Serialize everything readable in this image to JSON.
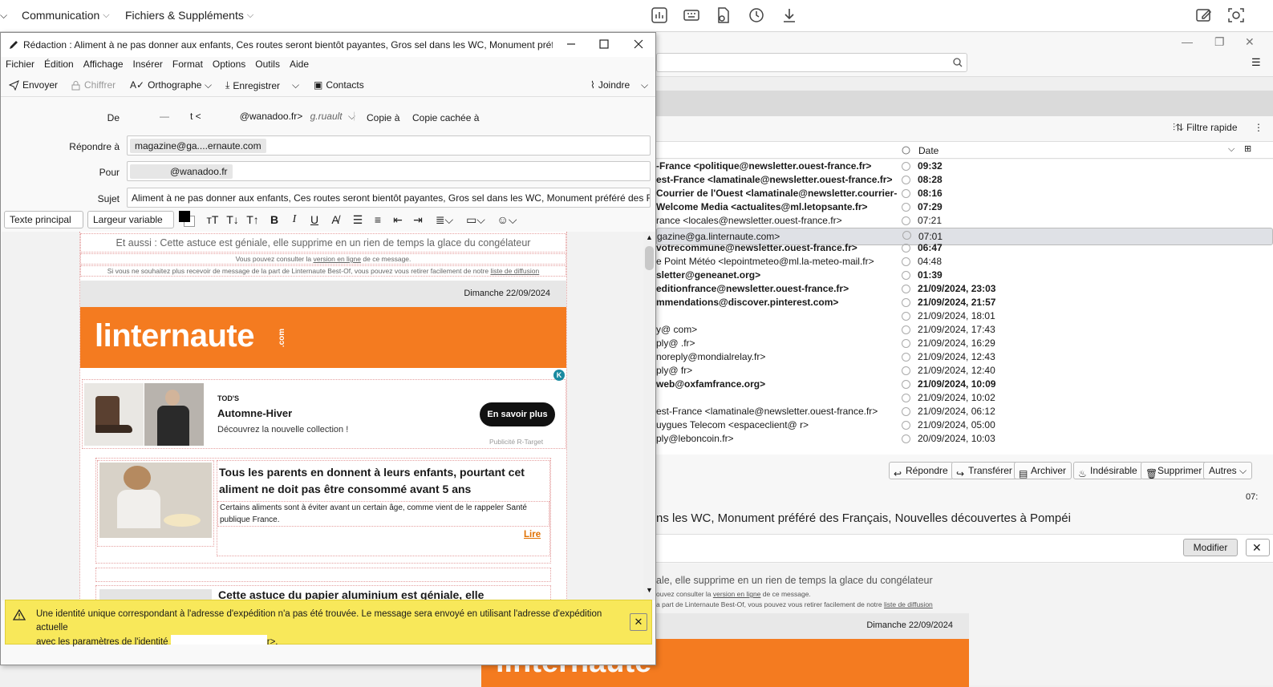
{
  "topbar": {
    "menu1": "Communication",
    "menu2": "Fichiers & Suppléments"
  },
  "compose": {
    "title": "Rédaction : Aliment à ne pas donner aux enfants, Ces routes seront bientôt payantes, Gros sel dans les WC, Monument préféré de...",
    "menu": [
      "Fichier",
      "Édition",
      "Affichage",
      "Insérer",
      "Format",
      "Options",
      "Outils",
      "Aide"
    ],
    "toolbar": {
      "send": "Envoyer",
      "encrypt": "Chiffrer",
      "spelling": "Orthographe",
      "save": "Enregistrer",
      "contacts": "Contacts",
      "attach": "Joindre"
    },
    "headers": {
      "from_label": "De",
      "from_value": "t <",
      "from_value2": "@wanadoo.fr>",
      "from_identity": "g.ruault",
      "cc": "Copie à",
      "bcc": "Copie cachée à",
      "reply_label": "Répondre à",
      "reply_value": "magazine@ga....ernaute.com",
      "to_label": "Pour",
      "to_value": "@wanadoo.fr",
      "subject_label": "Sujet",
      "subject_value": "Aliment à ne pas donner aux enfants, Ces routes seront bientôt payantes, Gros sel dans les WC, Monument préféré des Français, N"
    },
    "format": {
      "paragraph": "Texte principal",
      "font": "Largeur variable"
    },
    "newsletter": {
      "teaser": "Et aussi : Cette astuce est géniale, elle supprime en un rien de temps la glace du congélateur",
      "online_pre": "Vous pouvez consulter la ",
      "online_link": "version en ligne",
      "online_post": " de ce message.",
      "unsub_pre": "Si vous ne souhaitez plus recevoir de message de la part de Linternaute Best-Of, vous pouvez vous retirer facilement de notre ",
      "unsub_link": "liste de diffusion",
      "date": "Dimanche 22/09/2024",
      "logo": "linternaute",
      "logo_com": ".com",
      "ad_brand": "TOD'S",
      "ad_title": "Automne-Hiver",
      "ad_desc": "Découvrez la nouvelle collection !",
      "ad_cta": "En savoir plus",
      "ad_credit": "Publicité R-Target",
      "ad_badge": "K",
      "article1_title": "Tous les parents en donnent à leurs enfants, pourtant cet aliment ne doit pas être consommé avant 5 ans",
      "article1_desc": "Certains aliments sont à éviter avant un certain âge, comme vient de le rappeler Santé publique France.",
      "article1_link": "Lire",
      "article2_title": "Cette astuce du papier aluminium est géniale, elle"
    },
    "warning": {
      "line1": "Une identité unique correspondant à l'adresse d'expédition n'a pas été trouvée. Le message sera envoyé en utilisant l'adresse d'expédition actuelle",
      "line2_pre": "avec les paramètres de l'identité ",
      "line2_post": "r>."
    }
  },
  "background": {
    "filter": "Filtre rapide",
    "col_date": "Date",
    "messages": [
      {
        "from": "-France <politique@newsletter.ouest-france.fr>",
        "date": "09:32",
        "bold": true
      },
      {
        "from": "est-France <lamatinale@newsletter.ouest-france.fr>",
        "date": "08:28",
        "bold": true
      },
      {
        "from": "Courrier de l'Ouest <lamatinale@newsletter.courrier-o...",
        "date": "08:16",
        "bold": true
      },
      {
        "from": "Welcome Media <actualites@ml.letopsante.fr>",
        "date": "07:29",
        "bold": true
      },
      {
        "from": "rance <locales@newsletter.ouest-france.fr>",
        "date": "07:21",
        "bold": false
      },
      {
        "from": "gazine@ga.linternaute.com>",
        "date": "07:01",
        "bold": false,
        "selected": true
      },
      {
        "from": "votrecommune@newsletter.ouest-france.fr>",
        "date": "06:47",
        "bold": true
      },
      {
        "from": "e Point Météo <lepointmeteo@ml.la-meteo-mail.fr>",
        "date": "04:48",
        "bold": false
      },
      {
        "from": "sletter@geneanet.org>",
        "date": "01:39",
        "bold": true
      },
      {
        "from": "editionfrance@newsletter.ouest-france.fr>",
        "date": "21/09/2024, 23:03",
        "bold": true
      },
      {
        "from": "mmendations@discover.pinterest.com>",
        "date": "21/09/2024, 21:57",
        "bold": true
      },
      {
        "from": "",
        "date": "21/09/2024, 18:01",
        "bold": false
      },
      {
        "from": "y@             com>",
        "date": "21/09/2024, 17:43",
        "bold": false
      },
      {
        "from": "ply@            .fr>",
        "date": "21/09/2024, 16:29",
        "bold": false
      },
      {
        "from": "noreply@mondialrelay.fr>",
        "date": "21/09/2024, 12:43",
        "bold": false
      },
      {
        "from": "ply@          fr>",
        "date": "21/09/2024, 12:40",
        "bold": false
      },
      {
        "from": "web@oxfamfrance.org>",
        "date": "21/09/2024, 10:09",
        "bold": true
      },
      {
        "from": "",
        "date": "21/09/2024, 10:02",
        "bold": false
      },
      {
        "from": "est-France <lamatinale@newsletter.ouest-france.fr>",
        "date": "21/09/2024, 06:12",
        "bold": false
      },
      {
        "from": "uygues Telecom <espaceclient@              r>",
        "date": "21/09/2024, 05:00",
        "bold": false
      },
      {
        "from": "ply@leboncoin.fr>",
        "date": "20/09/2024, 10:03",
        "bold": false
      }
    ],
    "actions": [
      "Répondre",
      "Transférer",
      "Archiver",
      "Indésirable",
      "Supprimer",
      "Autres"
    ],
    "time": "07:",
    "subject": "ns les WC, Monument préféré des Français, Nouvelles découvertes à Pompéi",
    "modify": "Modifier",
    "preview_teaser": "ale, elle supprime en un rien de temps la glace du congélateur",
    "preview_online_pre": "ouvez consulter la ",
    "preview_online_link": "version en ligne",
    "preview_online_post": " de ce message.",
    "preview_unsub_pre": "a part de Linternaute Best-Of, vous pouvez vous retirer facilement de notre ",
    "preview_unsub_link": "liste de diffusion",
    "preview_date": "Dimanche 22/09/2024",
    "preview_logo": "linternaute",
    "preview_logo_com": ".com"
  },
  "colors": {
    "brand_orange": "#f47b20",
    "warning_yellow": "#f8e85a",
    "link_orange": "#e07000"
  }
}
